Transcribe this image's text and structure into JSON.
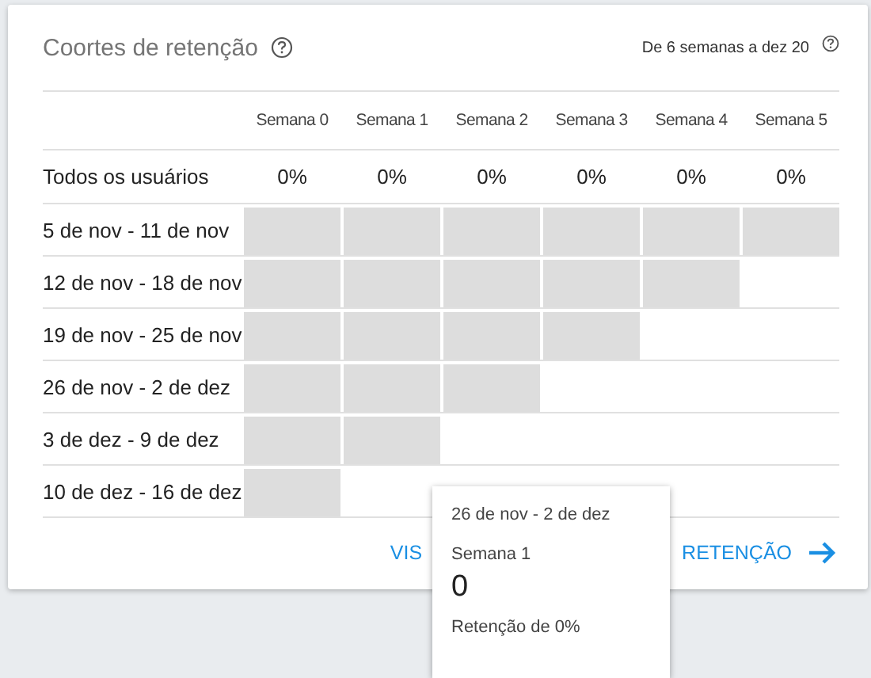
{
  "card": {
    "title": "Coortes de retenção",
    "range": "De 6 semanas a dez 20"
  },
  "weeks": [
    "Semana 0",
    "Semana 1",
    "Semana 2",
    "Semana 3",
    "Semana 4",
    "Semana 5"
  ],
  "all_users": {
    "label": "Todos os usuários",
    "values": [
      "0%",
      "0%",
      "0%",
      "0%",
      "0%",
      "0%"
    ]
  },
  "cohorts": [
    {
      "label": "5 de nov - 11 de nov",
      "cells": [
        {
          "filled": true
        },
        {
          "filled": true
        },
        {
          "filled": true
        },
        {
          "filled": true
        },
        {
          "filled": true
        },
        {
          "filled": true
        }
      ]
    },
    {
      "label": "12 de nov - 18 de nov",
      "cells": [
        {
          "filled": true
        },
        {
          "filled": true
        },
        {
          "filled": true
        },
        {
          "filled": true
        },
        {
          "filled": true
        },
        {
          "filled": false
        }
      ]
    },
    {
      "label": "19 de nov - 25 de nov",
      "cells": [
        {
          "filled": true
        },
        {
          "filled": true
        },
        {
          "filled": true
        },
        {
          "filled": true
        },
        {
          "filled": false
        },
        {
          "filled": false
        }
      ]
    },
    {
      "label": "26 de nov - 2 de dez",
      "cells": [
        {
          "filled": true
        },
        {
          "filled": true
        },
        {
          "filled": true
        },
        {
          "filled": false
        },
        {
          "filled": false
        },
        {
          "filled": false
        }
      ]
    },
    {
      "label": "3 de dez - 9 de dez",
      "cells": [
        {
          "filled": true
        },
        {
          "filled": true
        },
        {
          "filled": false
        },
        {
          "filled": false
        },
        {
          "filled": false
        },
        {
          "filled": false
        }
      ]
    },
    {
      "label": "10 de dez - 16 de dez",
      "cells": [
        {
          "filled": true
        },
        {
          "filled": false
        },
        {
          "filled": false
        },
        {
          "filled": false
        },
        {
          "filled": false
        },
        {
          "filled": false
        }
      ]
    }
  ],
  "link": {
    "text_start": "VIS",
    "text_end": "RETENÇÃO"
  },
  "tooltip": {
    "cohort": "26 de nov - 2 de dez",
    "week": "Semana 1",
    "value": "0",
    "retention": "Retenção de 0%"
  }
}
